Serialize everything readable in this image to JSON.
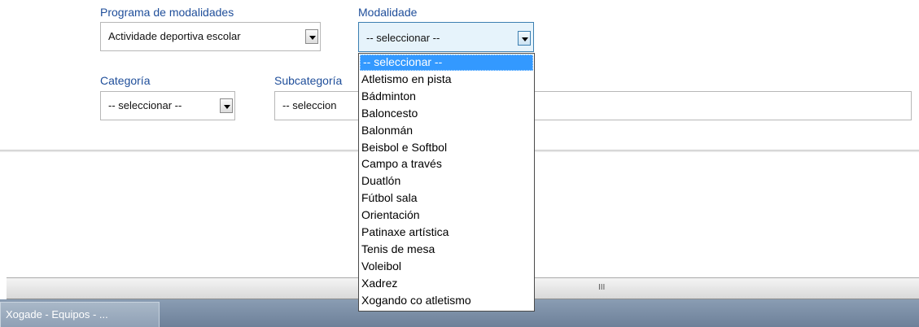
{
  "filters": {
    "programa": {
      "label": "Programa de modalidades",
      "value": "Actividade deportiva escolar"
    },
    "modalidade": {
      "label": "Modalidade",
      "value": "-- seleccionar --"
    },
    "categoria": {
      "label": "Categoría",
      "value": "-- seleccionar --"
    },
    "subcategoria": {
      "label": "Subcategoría",
      "value": "-- seleccion"
    }
  },
  "dropdown": {
    "options": [
      "-- seleccionar --",
      "Atletismo en pista",
      "Bádminton",
      "Baloncesto",
      "Balonmán",
      "Beisbol e Softbol",
      "Campo a través",
      "Duatlón",
      "Fútbol sala",
      "Orientación",
      "Patinaxe artística",
      "Tenis de mesa",
      "Voleibol",
      "Xadrez",
      "Xogando co atletismo"
    ],
    "highlighted_index": 0
  },
  "scrollbar": {
    "grip": "III"
  },
  "taskbar": {
    "tab_label": "Xogade - Equipos - ..."
  },
  "colors": {
    "label": "#1f4e9a",
    "highlight": "#3399ff",
    "taskbar": "#7d90a8"
  }
}
